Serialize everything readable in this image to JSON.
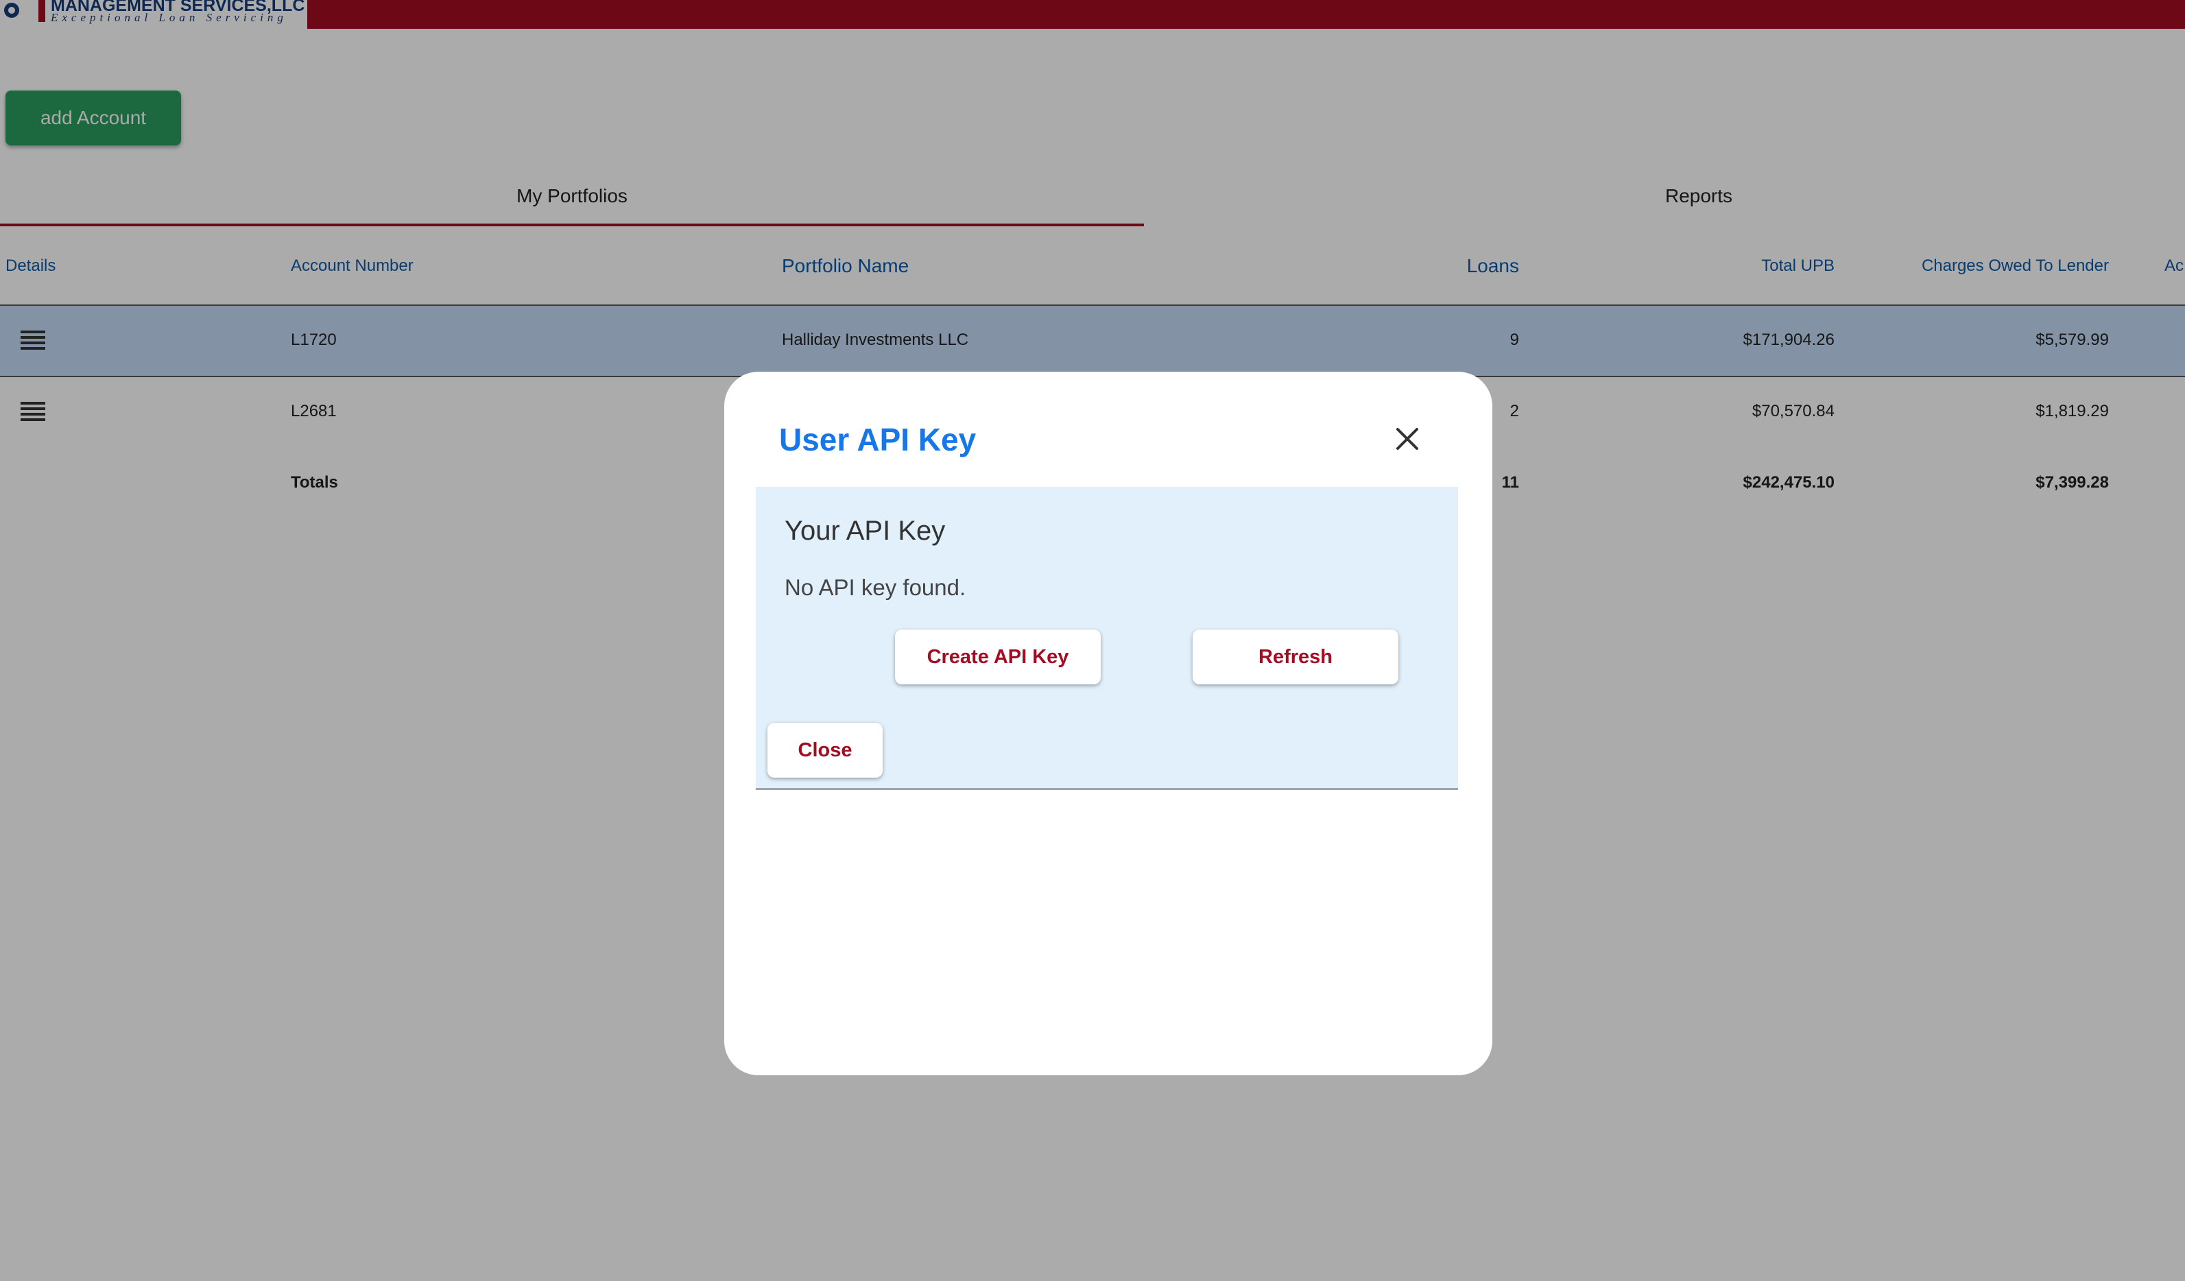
{
  "header": {
    "logo_title": "MANAGEMENT SERVICES,LLC",
    "logo_subtitle": "Exceptional Loan Servicing",
    "brand_color": "#a30d22"
  },
  "toolbar": {
    "add_account_label": "add Account"
  },
  "tabs": [
    {
      "label": "My Portfolios",
      "active": true
    },
    {
      "label": "Reports",
      "active": false
    }
  ],
  "table": {
    "columns": {
      "details": "Details",
      "account_number": "Account Number",
      "portfolio_name": "Portfolio Name",
      "loans": "Loans",
      "total_upb": "Total UPB",
      "charges_owed": "Charges Owed To Lender",
      "ac": "Ac"
    },
    "rows": [
      {
        "details_icon": "menu-icon",
        "account_number": "L1720",
        "portfolio_name": "Halliday Investments LLC",
        "loans": "9",
        "total_upb": "$171,904.26",
        "charges_owed": "$5,579.99"
      },
      {
        "details_icon": "menu-icon",
        "account_number": "L2681",
        "portfolio_name": "",
        "loans": "2",
        "total_upb": "$70,570.84",
        "charges_owed": "$1,819.29"
      }
    ],
    "totals": {
      "label": "Totals",
      "loans": "11",
      "total_upb": "$242,475.10",
      "charges_owed": "$7,399.28"
    }
  },
  "modal": {
    "title": "User API Key",
    "close_icon": "close-icon",
    "panel_heading": "Your API Key",
    "panel_text": "No API key found.",
    "create_label": "Create API Key",
    "refresh_label": "Refresh",
    "close_label": "Close"
  }
}
